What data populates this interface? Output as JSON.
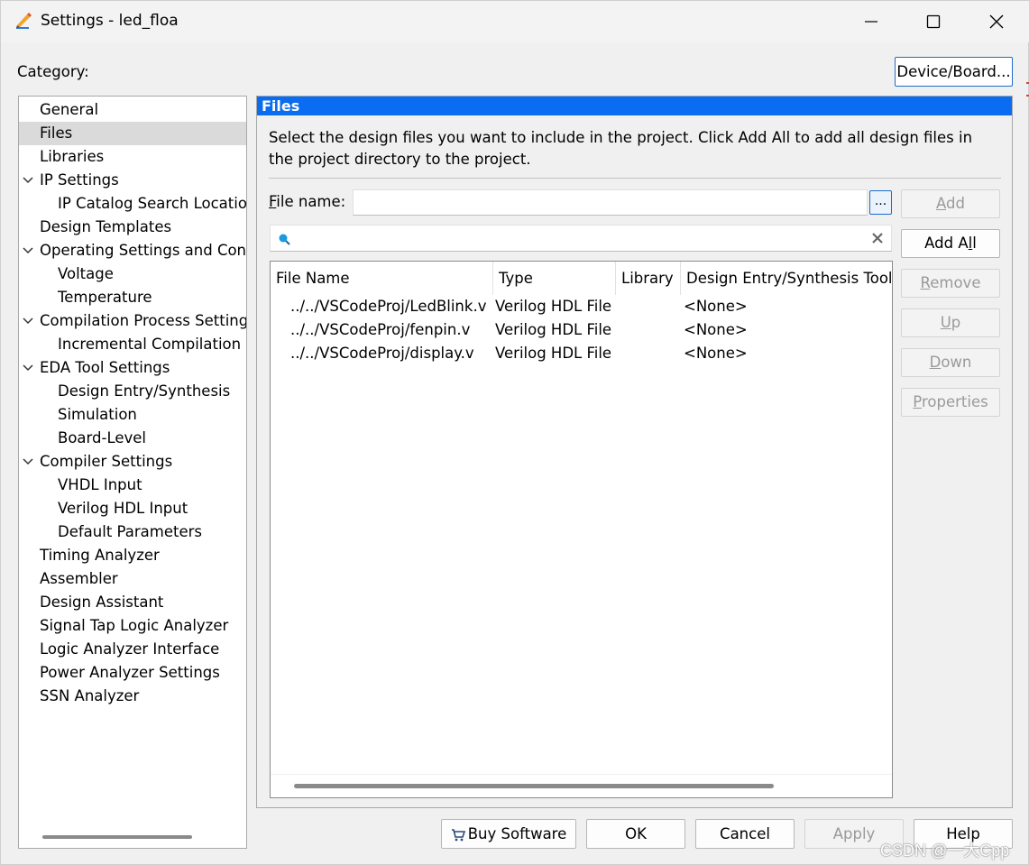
{
  "window": {
    "title": "Settings - led_floa"
  },
  "category_label": "Category:",
  "device_button_label": "Device/Board...",
  "tree": {
    "selected": "Files",
    "items": [
      {
        "label": "General",
        "level": 0,
        "expanded": false
      },
      {
        "label": "Files",
        "level": 0,
        "expanded": false
      },
      {
        "label": "Libraries",
        "level": 0,
        "expanded": false
      },
      {
        "label": "IP Settings",
        "level": 0,
        "expanded": true
      },
      {
        "label": "IP Catalog Search Location",
        "level": 1,
        "expanded": false
      },
      {
        "label": "Design Templates",
        "level": 0,
        "expanded": false
      },
      {
        "label": "Operating Settings and Conditions",
        "level": 0,
        "expanded": true
      },
      {
        "label": "Voltage",
        "level": 1,
        "expanded": false
      },
      {
        "label": "Temperature",
        "level": 1,
        "expanded": false
      },
      {
        "label": "Compilation Process Settings",
        "level": 0,
        "expanded": true
      },
      {
        "label": "Incremental Compilation",
        "level": 1,
        "expanded": false
      },
      {
        "label": "EDA Tool Settings",
        "level": 0,
        "expanded": true
      },
      {
        "label": "Design Entry/Synthesis",
        "level": 1,
        "expanded": false
      },
      {
        "label": "Simulation",
        "level": 1,
        "expanded": false
      },
      {
        "label": "Board-Level",
        "level": 1,
        "expanded": false
      },
      {
        "label": "Compiler Settings",
        "level": 0,
        "expanded": true
      },
      {
        "label": "VHDL Input",
        "level": 1,
        "expanded": false
      },
      {
        "label": "Verilog HDL Input",
        "level": 1,
        "expanded": false
      },
      {
        "label": "Default Parameters",
        "level": 1,
        "expanded": false
      },
      {
        "label": "Timing Analyzer",
        "level": 0,
        "expanded": false
      },
      {
        "label": "Assembler",
        "level": 0,
        "expanded": false
      },
      {
        "label": "Design Assistant",
        "level": 0,
        "expanded": false
      },
      {
        "label": "Signal Tap Logic Analyzer",
        "level": 0,
        "expanded": false
      },
      {
        "label": "Logic Analyzer Interface",
        "level": 0,
        "expanded": false
      },
      {
        "label": "Power Analyzer Settings",
        "level": 0,
        "expanded": false
      },
      {
        "label": "SSN Analyzer",
        "level": 0,
        "expanded": false
      }
    ]
  },
  "files_panel": {
    "header": "Files",
    "description": "Select the design files you want to include in the project. Click Add All to add all design files in the project directory to the project.",
    "file_name_label_accel": "F",
    "file_name_label_rest": "ile name:",
    "file_name_value": "",
    "browse_label": "...",
    "search_value": "",
    "columns": [
      "File Name",
      "Type",
      "Library",
      "Design Entry/Synthesis Tool"
    ],
    "rows": [
      {
        "file": "../../VSCodeProj/LedBlink.v",
        "type": "Verilog HDL File",
        "library": "",
        "tool": "<None>"
      },
      {
        "file": "../../VSCodeProj/fenpin.v",
        "type": "Verilog HDL File",
        "library": "",
        "tool": "<None>"
      },
      {
        "file": "../../VSCodeProj/display.v",
        "type": "Verilog HDL File",
        "library": "",
        "tool": "<None>"
      }
    ],
    "side_buttons": {
      "add": {
        "accel": "A",
        "rest": "dd",
        "enabled": false
      },
      "add_all": {
        "pre": "Add A",
        "accel": "l",
        "rest": "l",
        "enabled": true
      },
      "remove": {
        "accel": "R",
        "rest": "emove",
        "enabled": false
      },
      "up": {
        "accel": "U",
        "rest": "p",
        "enabled": false
      },
      "down": {
        "accel": "D",
        "rest": "own",
        "enabled": false
      },
      "properties": {
        "accel": "P",
        "rest": "roperties",
        "enabled": false
      }
    }
  },
  "footer": {
    "buy_software": "Buy Software",
    "ok": "OK",
    "cancel": "Cancel",
    "apply": "Apply",
    "help": "Help"
  },
  "watermark": "CSDN @一大Cpp",
  "colors": {
    "header_blue": "#0a6cf0",
    "accent_border": "#1e6dc6",
    "selection": "#dadada",
    "disabled_text": "#9a9a9a"
  }
}
